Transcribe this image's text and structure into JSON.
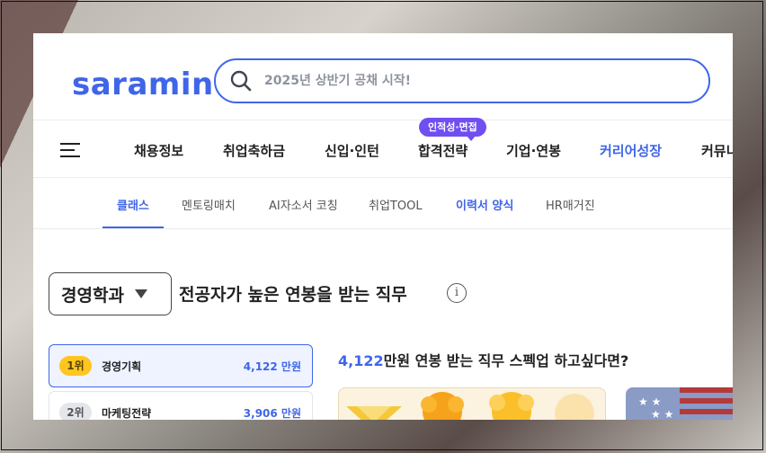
{
  "brand": {
    "logo": "saramin",
    "accent": "#3f66e8"
  },
  "search": {
    "placeholder": "2025년 상반기 공채 시작!"
  },
  "nav": {
    "items": [
      {
        "label": "채용정보"
      },
      {
        "label": "취업축하금"
      },
      {
        "label": "신입·인턴"
      },
      {
        "label": "합격전략"
      },
      {
        "label": "기업·연봉"
      },
      {
        "label": "커리어성장"
      },
      {
        "label": "커뮤니"
      }
    ],
    "badge": "인적성·면접"
  },
  "subnav": {
    "items": [
      {
        "label": "클래스"
      },
      {
        "label": "멘토링매치"
      },
      {
        "label": "AI자소서 코칭"
      },
      {
        "label": "취업TOOL"
      },
      {
        "label": "이력서 양식"
      },
      {
        "label": "HR매거진"
      }
    ]
  },
  "section": {
    "department": "경영학과",
    "title": "전공자가 높은 연봉을 받는 직무",
    "info_icon": "i"
  },
  "ranking": [
    {
      "rank": "1위",
      "name": "경영기획",
      "salary": "4,122 만원"
    },
    {
      "rank": "2위",
      "name": "마케팅전략",
      "salary": "3,906 만원"
    }
  ],
  "promo": {
    "amount": "4,122",
    "text": "만원 연봉 받는 직무 스펙업 하고싶다면?"
  }
}
